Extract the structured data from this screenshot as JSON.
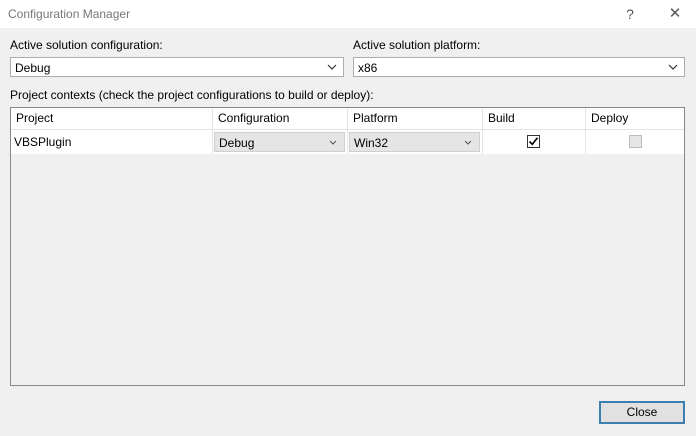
{
  "window": {
    "title": "Configuration Manager",
    "help_glyph": "?",
    "close_glyph": "✕"
  },
  "solution": {
    "config_label": "Active solution configuration:",
    "config_value": "Debug",
    "platform_label": "Active solution platform:",
    "platform_value": "x86"
  },
  "contexts": {
    "label": "Project contexts (check the project configurations to build or deploy):",
    "columns": [
      "Project",
      "Configuration",
      "Platform",
      "Build",
      "Deploy"
    ],
    "rows": [
      {
        "project": "VBSPlugin",
        "configuration": "Debug",
        "platform": "Win32",
        "build": true,
        "deploy": false
      }
    ]
  },
  "footer": {
    "close_label": "Close"
  },
  "colors": {
    "accent": "#3c7fb1",
    "window_bg": "#f0f0f0"
  }
}
